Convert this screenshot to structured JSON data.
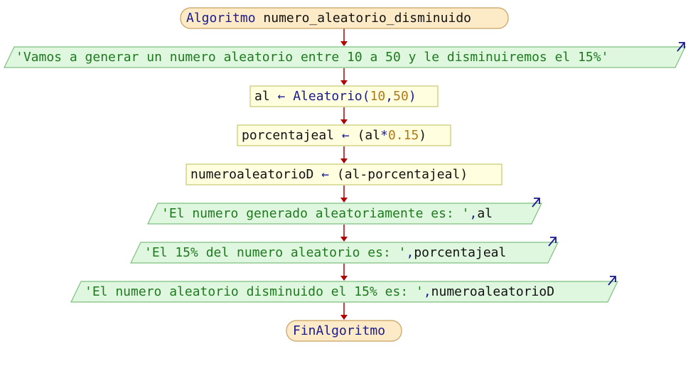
{
  "flowchart": {
    "colors": {
      "terminal_fill": "#fdebc8",
      "terminal_stroke": "#c8a060",
      "process_fill": "#ffffdf",
      "process_stroke": "#c8c870",
      "io_fill": "#dff7df",
      "io_stroke": "#7fbf7f",
      "arrow": "#b00000",
      "output_arrow": "#1a1a8f"
    },
    "start": {
      "keyword": "Algoritmo",
      "name": "numero_aleatorio_disminuido"
    },
    "output1": {
      "text": "'Vamos a generar un numero aleatorio entre 10 a 50 y le disminuiremos el 15%'"
    },
    "assign1": {
      "var": "al",
      "arrow": "←",
      "func": "Aleatorio(",
      "n1": "10",
      "comma": ",",
      "n2": "50",
      "close": ")"
    },
    "assign2": {
      "var": "porcentajeal",
      "arrow": "←",
      "open": "(al",
      "op": "*",
      "num": "0.15",
      "close": ")"
    },
    "assign3": {
      "var": "numeroaleatorioD",
      "arrow": "←",
      "expr": "(al-porcentajeal)"
    },
    "output2": {
      "str": "'El numero generado aleatoriamente es: '",
      "comma": ",",
      "var": "al"
    },
    "output3": {
      "str": "'El 15% del numero aleatorio es: '",
      "comma": ",",
      "var": "porcentajeal"
    },
    "output4": {
      "str": "'El numero aleatorio disminuido el 15% es: '",
      "comma": ",",
      "var": "numeroaleatorioD"
    },
    "end": {
      "keyword": "FinAlgoritmo"
    }
  }
}
